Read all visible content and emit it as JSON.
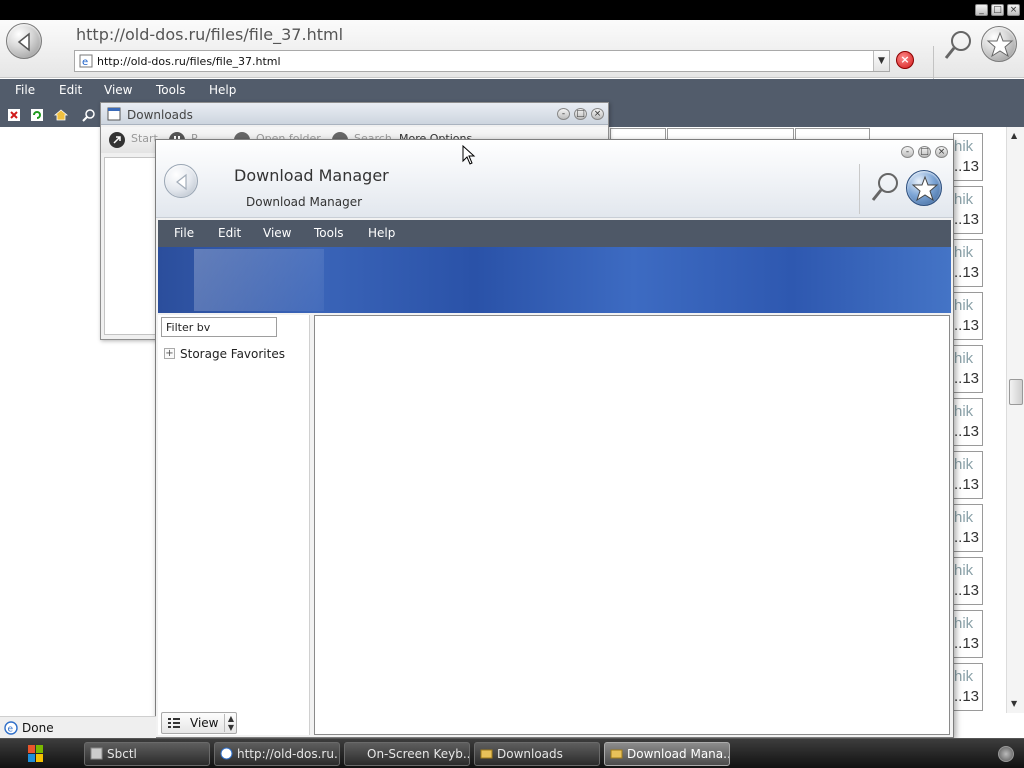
{
  "browser": {
    "page_title": "http://old-dos.ru/files/file_37.html",
    "address": "http://old-dos.ru/files/file_37.html"
  },
  "main_menu": [
    "File",
    "Edit",
    "View",
    "Tools",
    "Help"
  ],
  "page_cells": {
    "top_label": "hik",
    "bottom_label": "..13"
  },
  "downloads_window": {
    "title": "Downloads",
    "toolbar": [
      "Start",
      "P",
      "Open folder",
      "Search",
      "More Options"
    ]
  },
  "download_manager": {
    "title": "Download Manager",
    "subtitle": "Download Manager",
    "menu": [
      "File",
      "Edit",
      "View",
      "Tools",
      "Help"
    ],
    "filter_value": "Filter bv",
    "tree_item": "Storage Favorites",
    "view_button": "View"
  },
  "status": {
    "text": "Done"
  },
  "taskbar": {
    "items": [
      "Sbctl",
      "http://old-dos.ru...",
      "On-Screen Keyb...",
      "Downloads",
      "Download Mana..."
    ]
  },
  "colors": {
    "menu_bar": "#525c6b",
    "banner": "#2b4e9c",
    "taskbar": "#111111"
  },
  "icons": [
    "back-arrow-icon",
    "search-icon",
    "favorites-star-icon",
    "ie-page-icon",
    "stop-icon",
    "windows-start-icon"
  ]
}
